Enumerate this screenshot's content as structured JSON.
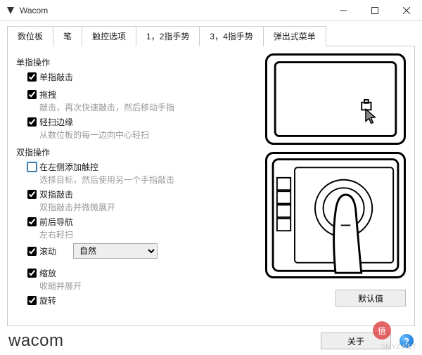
{
  "window": {
    "title": "Wacom"
  },
  "tabs": [
    "数位板",
    "笔",
    "触控选项",
    "1，2指手势",
    "3，4指手势",
    "弹出式菜单"
  ],
  "active_tab": 3,
  "sections": {
    "single": {
      "title": "单指操作",
      "items": [
        {
          "label": "单指敲击",
          "checked": true
        },
        {
          "label": "拖拽",
          "checked": true,
          "desc": "敲击，再次快速敲击，然后移动手指"
        },
        {
          "label": "轻扫边缘",
          "checked": true,
          "desc": "从数位板的每一边向中心轻扫"
        }
      ]
    },
    "double": {
      "title": "双指操作",
      "items": [
        {
          "label": "在左侧添加触控",
          "checked": false,
          "desc": "选择目标，然后使用另一个手指敲击",
          "highlight": true
        },
        {
          "label": "双指敲击",
          "checked": true,
          "desc": "双指敲击并微微展开"
        },
        {
          "label": "前后导航",
          "checked": true,
          "desc": "左右轻扫"
        },
        {
          "label": "滚动",
          "checked": true,
          "select": {
            "value": "自然",
            "options": [
              "自然"
            ]
          }
        },
        {
          "label": "缩放",
          "checked": true,
          "desc": "收缩并展开"
        },
        {
          "label": "旋转",
          "checked": true
        }
      ]
    }
  },
  "buttons": {
    "default": "默认值",
    "about": "关于"
  },
  "logo": "wacom",
  "watermark": {
    "badge": "值",
    "text": "SMYZ.NET"
  }
}
